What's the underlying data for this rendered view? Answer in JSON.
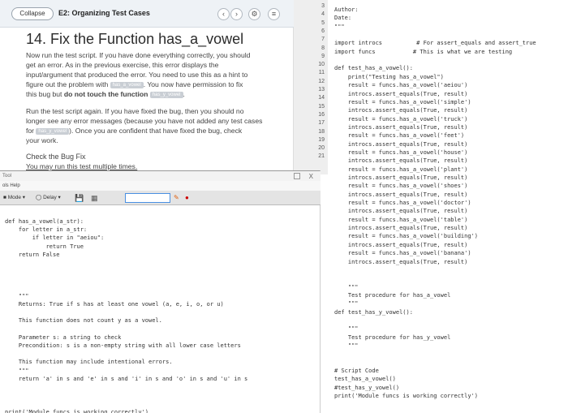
{
  "lesson": {
    "collapse_label": "Collapse",
    "title_bar": "E2: Organizing Test Cases",
    "heading": "14. Fix the Function has_a_vowel",
    "p1": [
      "Now run the test script. If you have done everything correctly, you should",
      "get an error. As in the previous exercise, this error displays the",
      "input/argument that produced the error. You need to use this as a hint to",
      "figure out the problem with",
      ". You now have permission to fix",
      "this bug but",
      "do not touch the function",
      "."
    ],
    "chip_a": "has_a_vowel",
    "chip_y": "has_y_vowel",
    "p2": [
      "Run the test script again. If you have fixed the bug, then you should no",
      "longer see any error messages (because you have not added any test cases",
      "for",
      "). Once you are confident that have fixed the bug, check",
      "your work."
    ],
    "check_link": "Check the Bug Fix",
    "may_run": "You may run this test multiple times."
  },
  "gutter_lines": [
    "3",
    "4",
    "5",
    "6",
    "7",
    "8",
    "9",
    "10",
    "11",
    "12",
    "13",
    "14",
    "15",
    "16",
    "17",
    "18",
    "19",
    "20",
    "21"
  ],
  "right_code": [
    "Author:",
    "Date:",
    "\"\"\"",
    "",
    "import introcs          # For assert_equals and assert_true",
    "import funcs           # This is what we are testing",
    "",
    "def test_has_a_vowel():",
    "    print(\"Testing has_a_vowel\")",
    "    result = funcs.has_a_vowel('aeiou')",
    "    introcs.assert_equals(True, result)",
    "    result = funcs.has_a_vowel('simple')",
    "    introcs.assert_equals(True, result)",
    "    result = funcs.has_a_vowel('truck')",
    "    introcs.assert_equals(True, result)",
    "    result = funcs.has_a_vowel('feet')",
    "    introcs.assert_equals(True, result)",
    "    result = funcs.has_a_vowel('house')",
    "    introcs.assert_equals(True, result)",
    "    result = funcs.has_a_vowel('plant')",
    "    introcs.assert_equals(True, result)",
    "    result = funcs.has_a_vowel('shoes')",
    "    introcs.assert_equals(True, result)",
    "    result = funcs.has_a_vowel('doctor')",
    "    introcs.assert_equals(True, result)",
    "    result = funcs.has_a_vowel('table')",
    "    introcs.assert_equals(True, result)",
    "    result = funcs.has_a_vowel('building')",
    "    introcs.assert_equals(True, result)",
    "    result = funcs.has_a_vowel('banana')",
    "    introcs.assert_equals(True, result)",
    "",
    "",
    "    \"\"\"",
    "    Test procedure for has_a_vowel",
    "    \"\"\"",
    "def test_has_y_vowel():",
    "",
    "    \"\"\"",
    "    Test procedure for has_y_vowel",
    "    \"\"\"",
    "",
    "",
    "# Script Code",
    "test_has_a_vowel()",
    "#test_has_y_vowel()",
    "print('Module funcs is working correctly')"
  ],
  "ide": {
    "title": "Tool",
    "menu": "ols  Help",
    "mode": "Mode",
    "delay": "Delay",
    "close": "X"
  },
  "ide_code": [
    "def has_a_vowel(a_str):",
    "    for letter in a_str:",
    "        if letter in \"aeiou\":",
    "            return True",
    "    return False",
    "",
    "",
    "",
    "",
    "    \"\"\"",
    "    Returns: True if s has at least one vowel (a, e, i, o, or u)",
    "",
    "    This function does not count y as a vowel.",
    "",
    "    Parameter s: a string to check",
    "    Precondition: s is a non-empty string with all lower case letters",
    "",
    "    This function may include intentional errors.",
    "    \"\"\"",
    "    return 'a' in s and 'e' in s and 'i' in s and 'o' in s and 'u' in s",
    "",
    "",
    "",
    "print('Module funcs is working correctly')"
  ]
}
